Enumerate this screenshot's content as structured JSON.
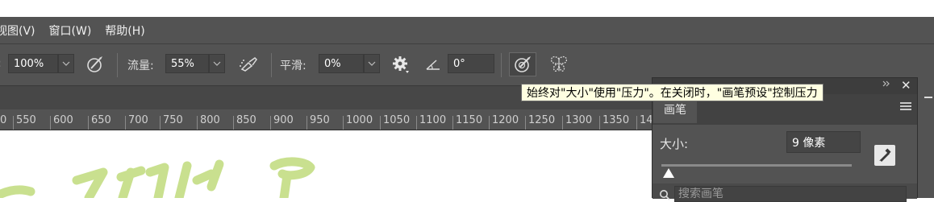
{
  "menu": {
    "items": [
      "视图(V)",
      "窗口(W)",
      "帮助(H)"
    ]
  },
  "options": {
    "opacity_value": "100%",
    "flow_label": "流量:",
    "flow_value": "55%",
    "smoothing_label": "平滑:",
    "smoothing_value": "0%",
    "angle_value": "0°",
    "tooltip": "始终对\"大小\"使用\"压力\"。在关闭时，\"画笔预设\"控制压力"
  },
  "ruler": {
    "ticks": [
      "0",
      "550",
      "600",
      "650",
      "700",
      "750",
      "800",
      "850",
      "900",
      "950",
      "1000",
      "1050",
      "1100",
      "1150",
      "1200",
      "1250",
      "1300",
      "1350",
      "14"
    ]
  },
  "brush_panel": {
    "tab_label": "画笔",
    "size_label": "大小:",
    "size_value": "9 像素",
    "search_placeholder": "搜索画笔"
  },
  "colors": {
    "ui_bg": "#535353",
    "tooltip_bg": "#ffffe1",
    "stroke_green": "#c9e08f"
  },
  "icons": [
    "pressure-opacity-icon",
    "airbrush-icon",
    "gear-icon",
    "angle-icon",
    "pressure-size-icon",
    "butterfly-symmetry-icon",
    "close-icon",
    "panel-menu-icon",
    "brush-settings-icon",
    "search-icon"
  ]
}
